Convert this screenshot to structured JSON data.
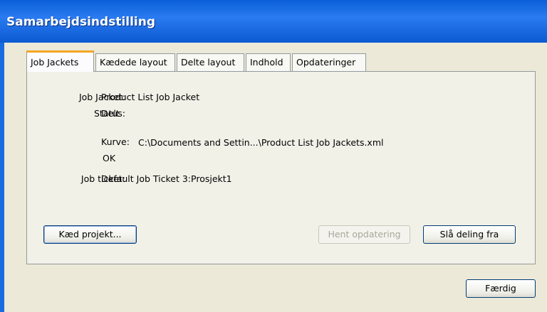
{
  "window": {
    "title": "Samarbejdsindstilling"
  },
  "tabs": [
    {
      "label": "Job Jackets",
      "active": true
    },
    {
      "label": "Kædede layout"
    },
    {
      "label": "Delte layout"
    },
    {
      "label": "Indhold"
    },
    {
      "label": "Opdateringer"
    }
  ],
  "fields": {
    "job_jacket_label": "Job Jacket:",
    "job_jacket_value": "Product List Job Jacket",
    "status_label": "Status:",
    "status_value": "Delt",
    "kurve_label": "Kurve:",
    "kurve_value": "C:\\Documents and Settin...\\Product List Job Jackets.xml",
    "kurve_status": "OK",
    "job_ticket_label": "Job ticket:",
    "job_ticket_value": "Default Job Ticket 3:Prosjekt1"
  },
  "buttons": {
    "link_project": "Kæd projekt...",
    "get_update": "Hent opdatering",
    "stop_sharing": "Slå deling fra",
    "done": "Færdig"
  }
}
